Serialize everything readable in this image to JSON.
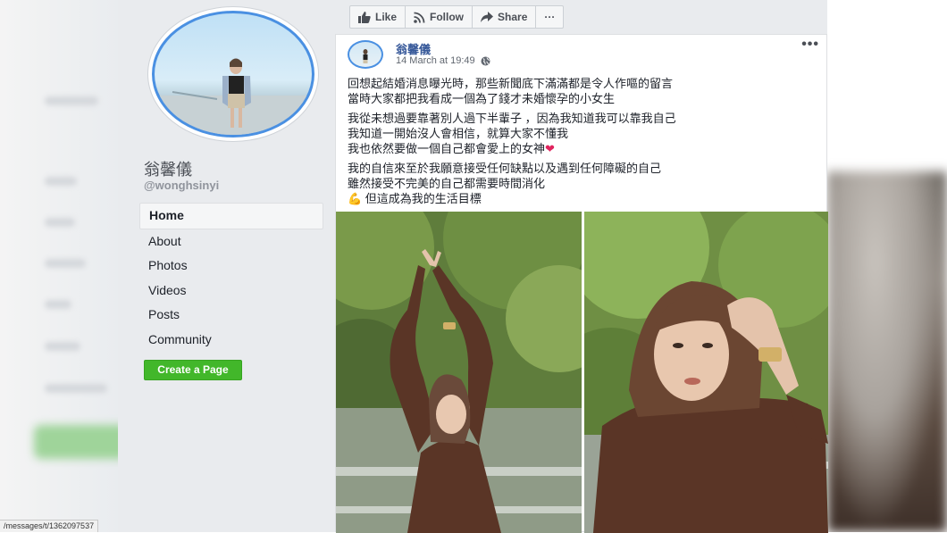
{
  "sidebar": {
    "page_name": "翁馨儀",
    "handle": "@wonghsinyi",
    "nav_items": [
      {
        "label": "Home",
        "active": true
      },
      {
        "label": "About"
      },
      {
        "label": "Photos"
      },
      {
        "label": "Videos"
      },
      {
        "label": "Posts"
      },
      {
        "label": "Community"
      }
    ],
    "create_page_label": "Create a Page",
    "status_url": "/messages/t/1362097537"
  },
  "actions": {
    "like": "Like",
    "follow": "Follow",
    "share": "Share",
    "more": "···"
  },
  "post": {
    "author": "翁馨儀",
    "timestamp": "14 March at 19:49",
    "privacy_icon": "globe-icon",
    "more": "•••",
    "lines": [
      "回想起結婚消息曝光時，那些新聞底下滿滿都是令人作嘔的留言",
      "當時大家都把我看成一個為了錢才未婚懷孕的小女生",
      "我從未想過要靠著別人過下半輩子 ，因為我知道我可以靠我自己",
      "我知道一開始沒人會相信，就算大家不懂我",
      "我也依然要做一個自己都會愛上的女神",
      "我的自信來至於我願意接受任何缺點以及遇到任何障礙的自己",
      "雖然接受不完美的自己都需要時間消化",
      "💪 但這成為我的生活目標"
    ],
    "heart": "❤"
  },
  "colors": {
    "link": "#365899",
    "create_button": "#42b72a",
    "profile_ring": "#4a90e2",
    "heart": "#e0245e"
  }
}
